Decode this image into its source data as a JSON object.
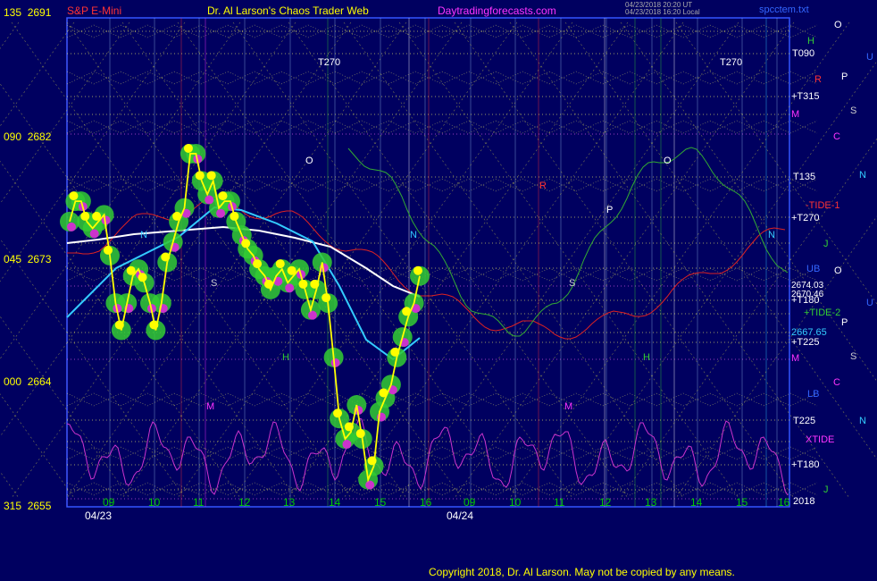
{
  "header": {
    "instrument": "S&P E-Mini",
    "title": "Dr. Al Larson's Chaos Trader Web",
    "site": "Daytradingforecasts.com",
    "stamp_line1": "04/23/2018 20:20 UT",
    "stamp_line2": "04/23/2018 16:20 Local",
    "file": "spcctem.txt"
  },
  "y_axis": [
    {
      "angle": "135",
      "price": "2691"
    },
    {
      "angle": "090",
      "price": "2682"
    },
    {
      "angle": "045",
      "price": "2673"
    },
    {
      "angle": "000",
      "price": "2664"
    },
    {
      "angle": "315",
      "price": "2655"
    }
  ],
  "right_labels": {
    "H": "H",
    "T090": "T090",
    "R": "R",
    "T315": "+T315",
    "M": "M",
    "T135": "T135",
    "TIDE1": "-TIDE-1",
    "T270": "+T270",
    "J": "J",
    "UB": "UB",
    "p1": "2674.03",
    "p2": "2670.46",
    "T180a": "+T180",
    "TIDE2": "+TIDE-2",
    "p3": "2667.65",
    "T225a": "+T225",
    "M2": "M",
    "LB": "LB",
    "T225": "T225",
    "XTIDE": "XTIDE",
    "T180": "+T180",
    "yr": "2018",
    "J2": "J"
  },
  "planets": [
    "O",
    "U",
    "P",
    "S",
    "C",
    "N",
    "O",
    "U",
    "P",
    "S",
    "C",
    "N"
  ],
  "x_hours": [
    "09",
    "10",
    "11",
    "12",
    "13",
    "14",
    "15",
    "16",
    "09",
    "10",
    "11",
    "12",
    "13",
    "14",
    "15",
    "16"
  ],
  "dates": [
    "04/23",
    "04/24"
  ],
  "flux_labels": [
    "T270",
    "T270",
    "O",
    "O",
    "P",
    "N",
    "N",
    "N",
    "S",
    "S",
    "H",
    "H",
    "M",
    "M",
    "R"
  ],
  "copyright": "Copyright 2018, Dr. Al Larson. May not be copied by any means.",
  "colors": {
    "background": "#000060",
    "price_bars": "#ffff00",
    "electric_field": "#33cc33",
    "magnetic_field": "#cc33cc",
    "ma_white": "#ffffff",
    "ma_cyan": "#33ccff",
    "tide1": "#dd2222",
    "tide2": "#33aa33",
    "xtide": "#cc33cc",
    "grid": "#ffff66"
  },
  "chart_data": {
    "type": "line",
    "title": "S&P E-Mini",
    "ylim": [
      2655,
      2691
    ],
    "y_ticks": [
      2655,
      2664,
      2673,
      2682,
      2691
    ],
    "y_tick_angles": [
      "315",
      "000",
      "045",
      "090",
      "135"
    ],
    "x_ticks": [
      "09",
      "10",
      "11",
      "12",
      "13",
      "14",
      "15",
      "16",
      "09",
      "10",
      "11",
      "12",
      "13",
      "14",
      "15",
      "16"
    ],
    "date_labels": [
      "04/23",
      "04/24"
    ],
    "price_levels": [
      2674.03,
      2670.46,
      2667.65
    ],
    "series": [
      {
        "values": [
          2676,
          2677.5,
          2677.5,
          2676,
          2675.5,
          2676,
          2676.5,
          2673.5,
          2670,
          2668,
          2670,
          2672,
          2672.5,
          2671.5,
          2670,
          2668,
          2670,
          2673,
          2674.5,
          2676,
          2677,
          2681,
          2681,
          2679,
          2678,
          2679,
          2677,
          2677.5,
          2677.5,
          2676,
          2675,
          2674,
          2673.5,
          2672.5,
          2672,
          2671,
          2672,
          2672.5,
          2671.5,
          2672,
          2672.5,
          2671,
          2669.5,
          2671,
          2673,
          2670,
          2666,
          2661.5,
          2660,
          2660.5,
          2662.5,
          2660,
          2657,
          2658,
          2662,
          2663,
          2664,
          2666,
          2667.5,
          2669,
          2670,
          2672
        ]
      }
    ]
  }
}
